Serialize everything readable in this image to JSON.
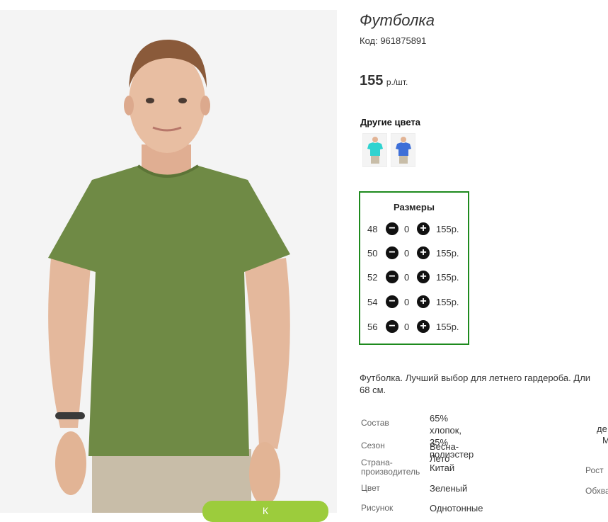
{
  "product": {
    "title": "Футболка",
    "code": "Код: 961875891",
    "price_value": "155",
    "price_unit": "р./шт.",
    "other_colors_label": "Другие цвета",
    "swatches": [
      {
        "color": "#2fd3d0"
      },
      {
        "color": "#3e6fd8"
      }
    ],
    "shirt_color": "#6f8a45"
  },
  "sizes": {
    "title": "Размеры",
    "rows": [
      {
        "size": "48",
        "qty": "0",
        "price": "155р."
      },
      {
        "size": "50",
        "qty": "0",
        "price": "155р."
      },
      {
        "size": "52",
        "qty": "0",
        "price": "155р."
      },
      {
        "size": "54",
        "qty": "0",
        "price": "155р."
      },
      {
        "size": "56",
        "qty": "0",
        "price": "155р."
      }
    ]
  },
  "description": {
    "line1": "Футболка. Лучший выбор для летнего гардероба. Дли",
    "line2": "68 см."
  },
  "properties": [
    {
      "label": "Состав",
      "value1": "65% хлопок,",
      "value2": "35% полиэстер"
    },
    {
      "label": "Сезон",
      "value1": "Весна-Лето"
    },
    {
      "label1": "Страна-",
      "label2": "производитель",
      "value1": "Китай"
    },
    {
      "label": "Цвет",
      "value1": "Зеленый"
    },
    {
      "label": "Рисунок",
      "value1": "Однотонные"
    }
  ],
  "side_labels": {
    "de": "де",
    "m": "М",
    "rost": "Рост",
    "obkhv": "Обхва"
  },
  "cart_button": {
    "label": "К"
  }
}
